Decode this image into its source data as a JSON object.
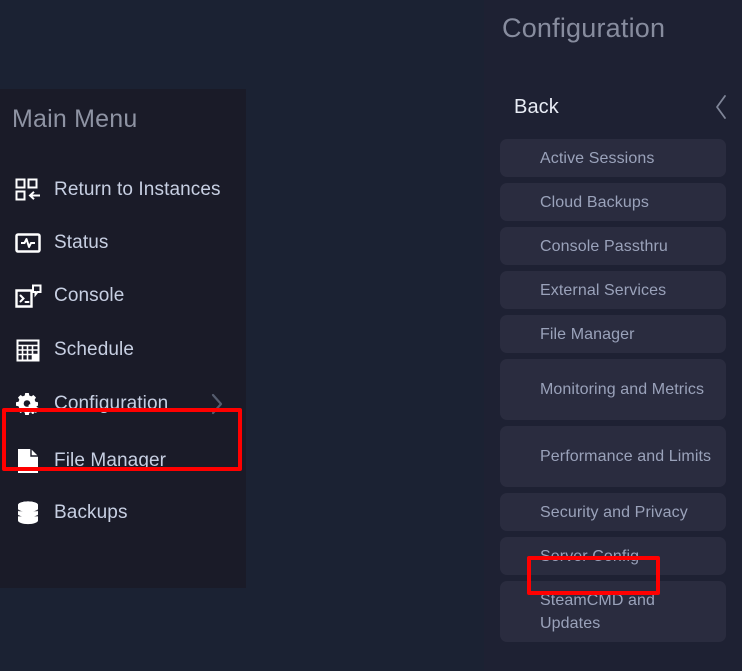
{
  "theme": {
    "page_background": "#1b2233",
    "menu_panel_background": "#1a1b28",
    "config_panel_background": "#1e2133",
    "config_item_background": "#2a2c3f",
    "annotation_color": "#ff0000",
    "heading_color": "#8e93a3",
    "label_color": "#c7cfe2",
    "config_label_color": "#9aa2ba"
  },
  "main_menu": {
    "title": "Main Menu",
    "items": [
      {
        "label": "Return to Instances",
        "icon": "return-to-instances-icon",
        "has_chevron": false,
        "highlighted": false
      },
      {
        "label": "Status",
        "icon": "status-monitor-icon",
        "has_chevron": false,
        "highlighted": false
      },
      {
        "label": "Console",
        "icon": "console-terminal-icon",
        "has_chevron": false,
        "highlighted": false
      },
      {
        "label": "Schedule",
        "icon": "schedule-calendar-icon",
        "has_chevron": false,
        "highlighted": false
      },
      {
        "label": "Configuration",
        "icon": "gears-icon",
        "has_chevron": true,
        "highlighted": true
      },
      {
        "label": "File Manager",
        "icon": "document-page-icon",
        "has_chevron": false,
        "highlighted": false
      },
      {
        "label": "Backups",
        "icon": "database-stack-icon",
        "has_chevron": false,
        "highlighted": false
      }
    ]
  },
  "config_panel": {
    "title": "Configuration",
    "back_label": "Back",
    "back_icon": "chevron-left-icon",
    "items": [
      {
        "label": "Active Sessions",
        "two_line": false,
        "highlighted": false
      },
      {
        "label": "Cloud Backups",
        "two_line": false,
        "highlighted": false
      },
      {
        "label": "Console Passthru",
        "two_line": false,
        "highlighted": false
      },
      {
        "label": "External Services",
        "two_line": false,
        "highlighted": false
      },
      {
        "label": "File Manager",
        "two_line": false,
        "highlighted": false
      },
      {
        "label": "Monitoring and Metrics",
        "two_line": true,
        "highlighted": false
      },
      {
        "label": "Performance and Limits",
        "two_line": true,
        "highlighted": false
      },
      {
        "label": "Security and Privacy",
        "two_line": false,
        "highlighted": false
      },
      {
        "label": "Server Config",
        "two_line": false,
        "highlighted": true
      },
      {
        "label": "SteamCMD and Updates",
        "two_line": true,
        "highlighted": false
      }
    ]
  }
}
